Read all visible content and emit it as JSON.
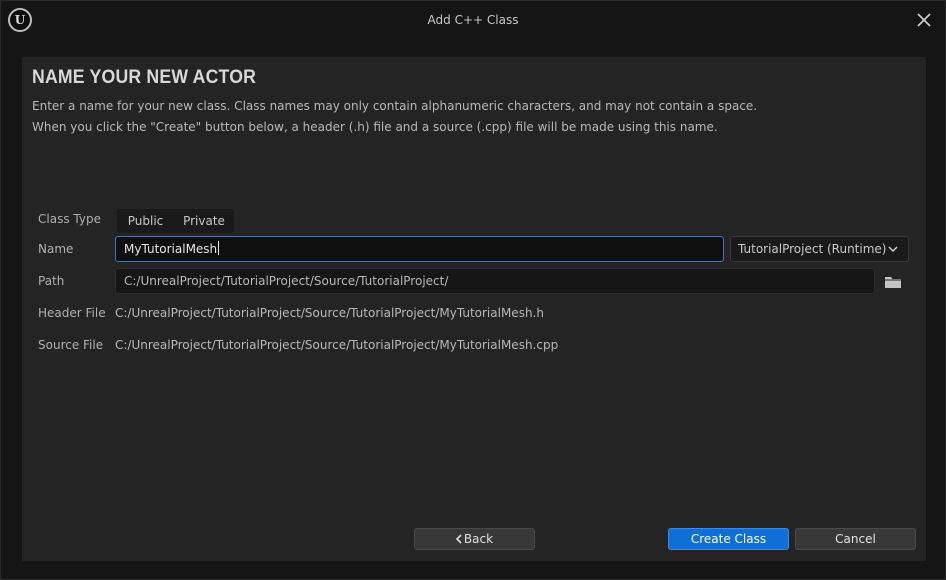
{
  "window": {
    "title": "Add C++ Class",
    "logo_letter": "U"
  },
  "page": {
    "heading": "NAME YOUR NEW ACTOR",
    "description_line1": "Enter a name for your new class. Class names may only contain alphanumeric characters, and may not contain a space.",
    "description_line2": "When you click the \"Create\" button below, a header (.h) file and a source (.cpp) file will be made using this name."
  },
  "form": {
    "class_type_label": "Class Type",
    "class_type_options": [
      "Public",
      "Private"
    ],
    "name_label": "Name",
    "name_value": "MyTutorialMesh",
    "module_value": "TutorialProject (Runtime)",
    "path_label": "Path",
    "path_value": "C:/UnrealProject/TutorialProject/Source/TutorialProject/",
    "header_label": "Header File",
    "header_value": "C:/UnrealProject/TutorialProject/Source/TutorialProject/MyTutorialMesh.h",
    "source_label": "Source File",
    "source_value": "C:/UnrealProject/TutorialProject/Source/TutorialProject/MyTutorialMesh.cpp"
  },
  "buttons": {
    "back": "Back",
    "create": "Create Class",
    "cancel": "Cancel"
  },
  "icons": {
    "logo": "unreal-logo-icon",
    "close": "close-icon",
    "dropdown": "chevron-down-icon",
    "folder": "folder-icon",
    "back": "chevron-left-icon"
  },
  "colors": {
    "background": "#151515",
    "panel": "#242424",
    "accent": "#0f6fd6",
    "focus_border": "#3e76c6"
  }
}
